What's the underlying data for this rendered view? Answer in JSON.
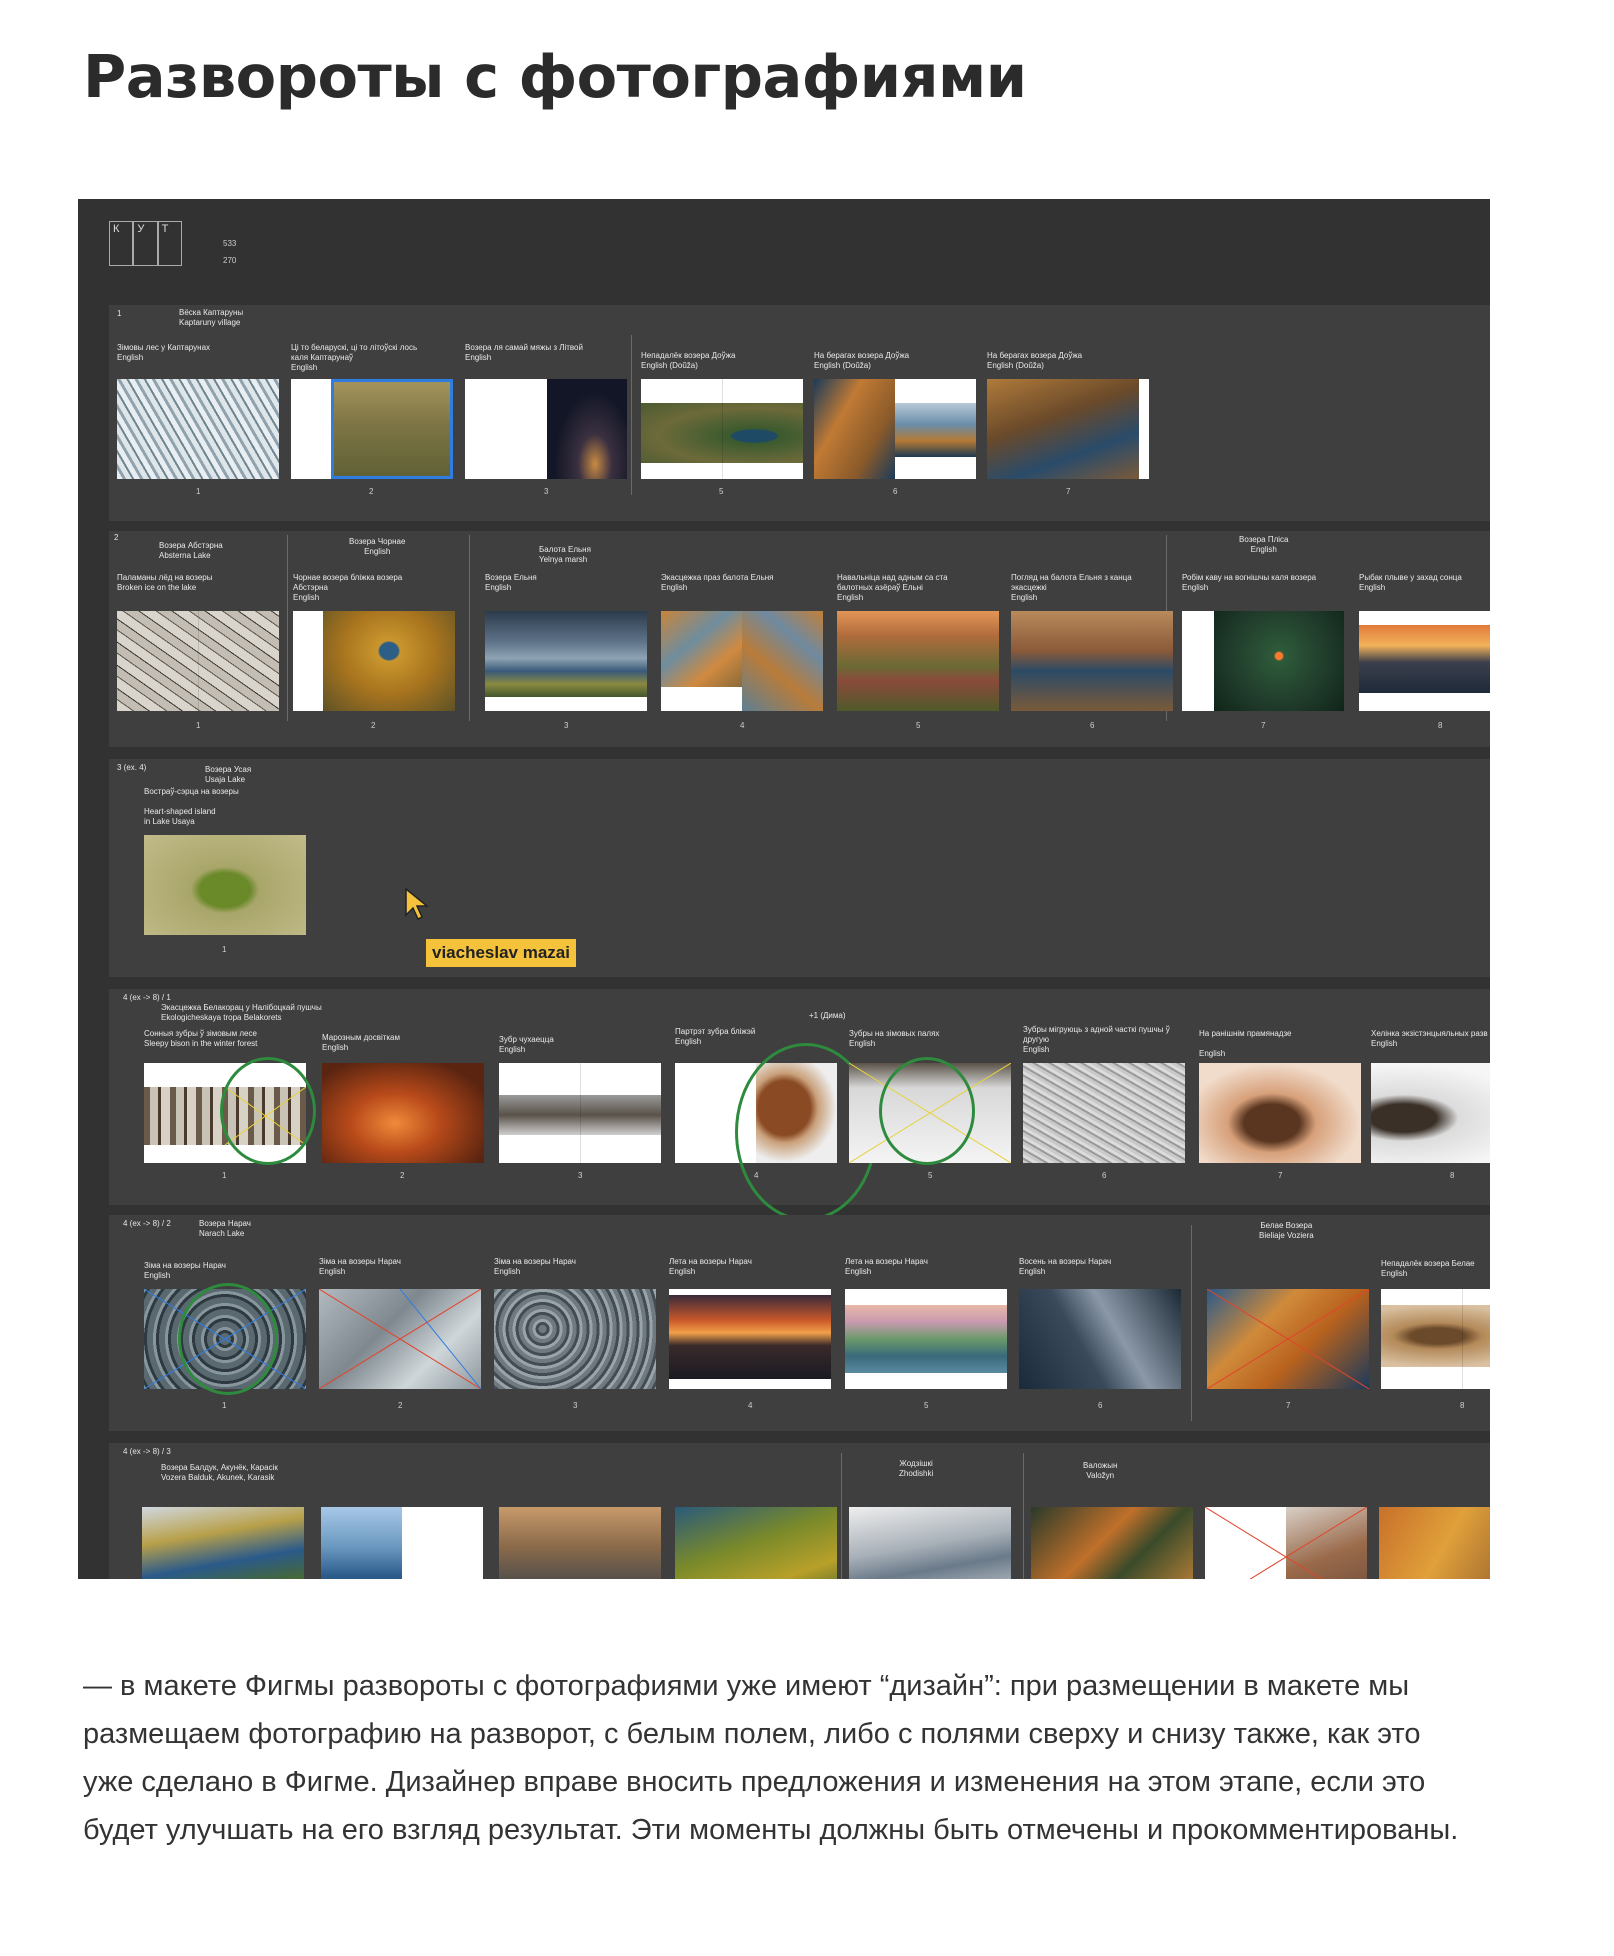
{
  "title": "Развороты с фотографиями",
  "canvas": {
    "kut": [
      "К",
      "У",
      "Т"
    ],
    "corner_numbers": [
      "533",
      "270"
    ],
    "cursor_user": "viacheslav mazai",
    "sections": [
      {
        "label": "1",
        "group_titles": [
          "Вёска Каптаруны\nKaptaruny village"
        ],
        "spreads": [
          {
            "caption": "Зімовы лес у Каптарунах\nEnglish",
            "num": "1"
          },
          {
            "caption": "Ці то беларускі, ці то літоўскі лось\nкаля Каптарунаў\nEnglish",
            "num": "2"
          },
          {
            "caption": "Возера ля самай мяжы з Літвой\nEnglish",
            "num": "3"
          },
          {
            "caption": "Непадалёк возера Доўжа\nEnglish (Doŭža)",
            "num": "5"
          },
          {
            "caption": "На берагах возера Доўжа\nEnglish (Doŭža)",
            "num": "6"
          },
          {
            "caption": "На берагах возера Доўжа\nEnglish (Doŭža)",
            "num": "7"
          }
        ]
      },
      {
        "label": "2",
        "group_titles": [
          "Возера Абстэрна\nAbsterna Lake",
          "Возера Чорнае\nEnglish",
          "Балота Ельня\nYelnya marsh",
          "Возера Пліса\nEnglish"
        ],
        "spreads": [
          {
            "caption": "Паламаны лёд на возеры\nBroken ice on the lake",
            "num": "1"
          },
          {
            "caption": "Чорнае возера бліжка возера\nАбстэрна\nEnglish",
            "num": "2"
          },
          {
            "caption": "Возера Ельня\nEnglish",
            "num": "3"
          },
          {
            "caption": "Экасцежка праз балота Ельня\nEnglish",
            "num": "4"
          },
          {
            "caption": "Навальніца над адным са ста\nбалотных азёраў Ельні\nEnglish",
            "num": "5"
          },
          {
            "caption": "Погляд на балота Ельня з канца\nэкасцежкі\nEnglish",
            "num": "6"
          },
          {
            "caption": "Робім каву на вогнішчы каля возера\nEnglish",
            "num": "7"
          },
          {
            "caption": "Рыбак плыве у захад сонца\nEnglish",
            "num": "8"
          }
        ]
      },
      {
        "label": "3 (ex. 4)",
        "group_titles": [
          "Возера Усая\nUsaja Lake"
        ],
        "spreads": [
          {
            "caption": "Востраў-сэрца на возеры\n\nHeart-shaped island\nin Lake Usaya",
            "num": "1"
          }
        ]
      },
      {
        "label": "4 (ex -> 8) / 1",
        "group_titles": [
          "Экасцежка Белакорац у Налібоцкай пушчы\nEkologicheskaya tropa Belakorets"
        ],
        "note": "+1 (Дима)",
        "spreads": [
          {
            "caption": "Сонныя зубры ў зімовым лесе\nSleepy bison in the winter forest",
            "num": "1"
          },
          {
            "caption": "Марозным досвіткам\nEnglish",
            "num": "2"
          },
          {
            "caption": "Зубр чухаецца\nEnglish",
            "num": "3"
          },
          {
            "caption": "Партрэт зубра бліжэй\nEnglish",
            "num": "4"
          },
          {
            "caption": "Зубры на зімовых палях\nEnglish",
            "num": "5"
          },
          {
            "caption": "Зубры мігруюць з адной часткі пушчы ў\nдругую\nEnglish",
            "num": "6"
          },
          {
            "caption": "На ранішнім прамянадзе\n\nEnglish",
            "num": "7"
          },
          {
            "caption": "Хелінка экзістэнцыяльных разв\nEnglish",
            "num": "8"
          }
        ]
      },
      {
        "label": "4 (ex -> 8) / 2",
        "group_titles": [
          "Возера Нарач\nNarach Lake",
          "Белае Возера\nBieliaje Voziera"
        ],
        "spreads": [
          {
            "caption": "Зіма на возеры Нарач\nEnglish",
            "num": "1"
          },
          {
            "caption": "Зіма на возеры Нарач\nEnglish",
            "num": "2"
          },
          {
            "caption": "Зіма на возеры Нарач\nEnglish",
            "num": "3"
          },
          {
            "caption": "Лета на возеры Нарач\nEnglish",
            "num": "4"
          },
          {
            "caption": "Лета на возеры Нарач\nEnglish",
            "num": "5"
          },
          {
            "caption": "Восень на возеры Нарач\nEnglish",
            "num": "6"
          },
          {
            "caption": "",
            "num": "7"
          },
          {
            "caption": "Непадалёк возера Белае\nEnglish",
            "num": "8"
          }
        ]
      },
      {
        "label": "4 (ex -> 8) / 3",
        "group_titles": [
          "Возера Балдук, Акунёк, Карасік\nVozera Balduk, Akunek, Karasik",
          "Жодзішкі\nZhodishki",
          "Валожын\nValožyn"
        ],
        "spreads": []
      }
    ]
  },
  "body_text": "— в макете Фигмы развороты с фотографиями уже имеют “дизайн”: при размещении в макете мы размещаем фотографию на разворот, с белым полем, либо с полями сверху и снизу также, как это уже сделано в Фигме. Дизайнер вправе вносить предложения и изменения на этом этапе, если это будет улучшать на его взгляд результат. Эти моменты должны быть отмечены и прокомментированы.",
  "colors": {
    "canvas_bg": "#323232",
    "section_bg": "#3f3f3f",
    "selection_blue": "#2f7de1",
    "review_circle_green": "#2e8b3e",
    "cursor_tag_yellow": "#f5c33b",
    "cross_red": "#e0452c",
    "cross_yellow": "#e6d23a"
  }
}
